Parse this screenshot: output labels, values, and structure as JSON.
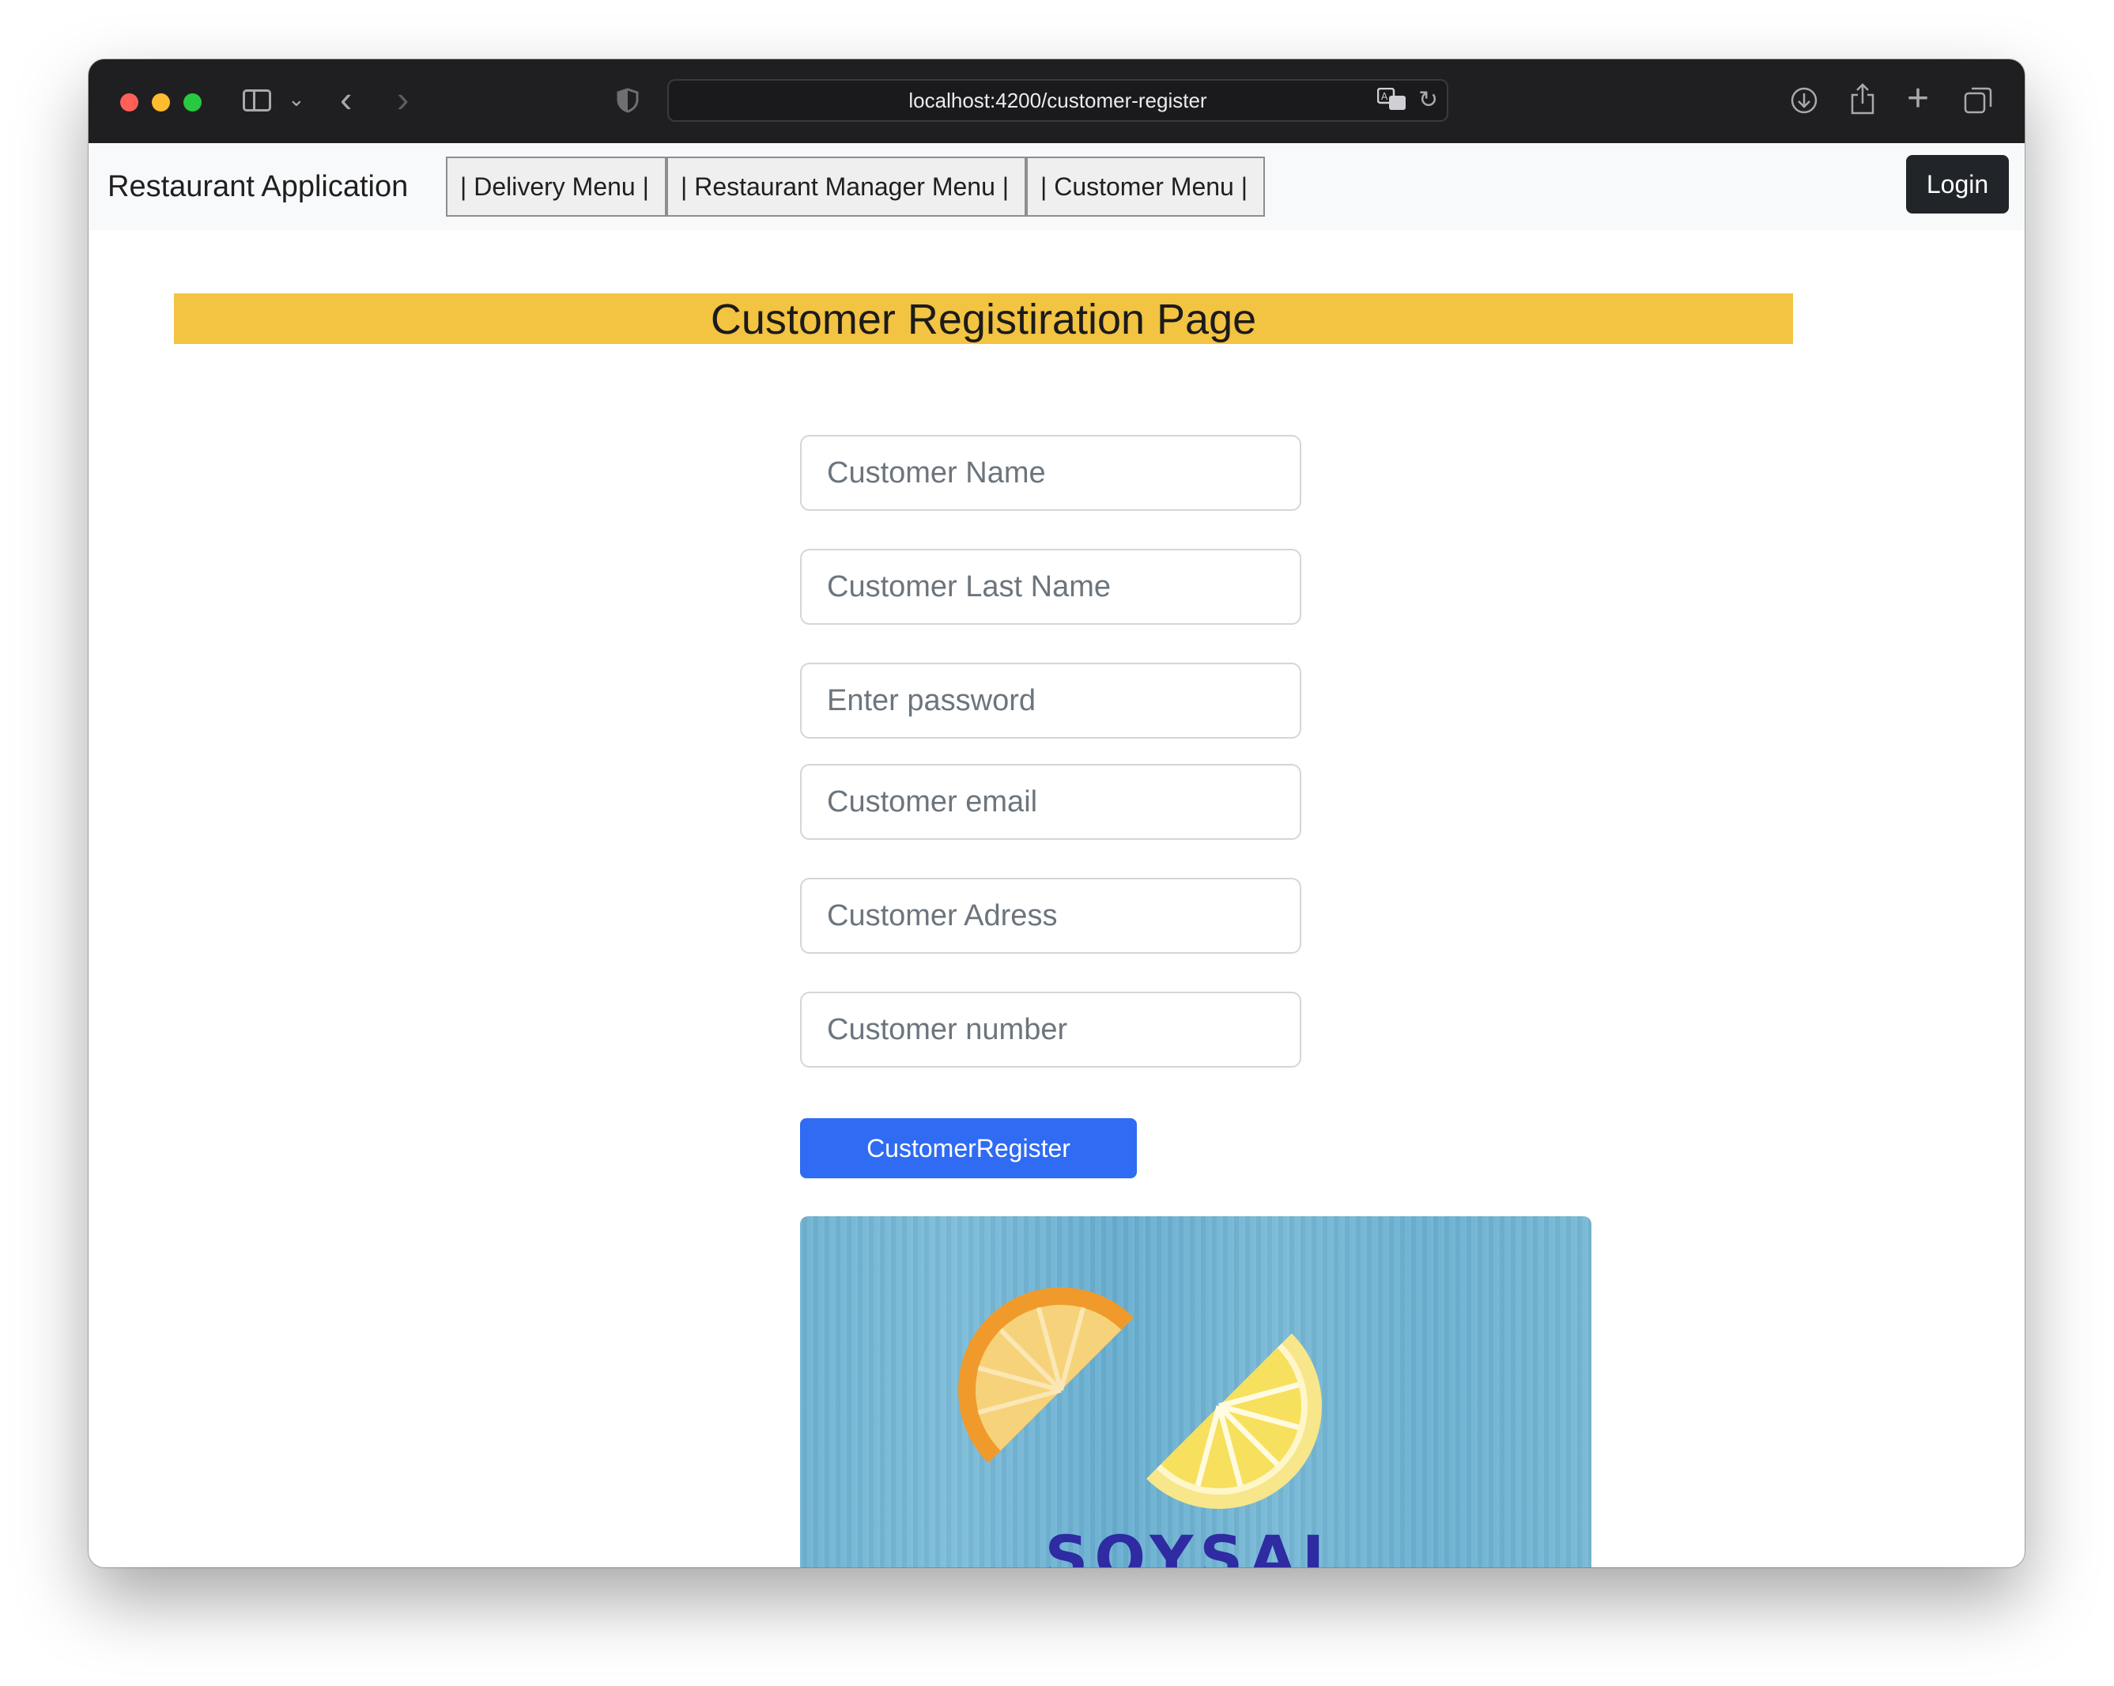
{
  "browser": {
    "url": "localhost:4200/customer-register"
  },
  "navbar": {
    "brand": "Restaurant Application",
    "links": [
      "| Delivery Menu |",
      "| Restaurant Manager Menu |",
      "| Customer Menu |"
    ],
    "login_label": "Login"
  },
  "page": {
    "heading": "Customer Registiration Page",
    "fields": [
      {
        "placeholder": "Customer Name",
        "value": ""
      },
      {
        "placeholder": "Customer Last Name",
        "value": ""
      },
      {
        "placeholder": "Enter password",
        "value": ""
      },
      {
        "placeholder": "Customer email",
        "value": ""
      },
      {
        "placeholder": "Customer Adress",
        "value": ""
      },
      {
        "placeholder": "Customer number",
        "value": ""
      }
    ],
    "register_label": "CustomerRegister",
    "banner_logo_text": "SOYSAL"
  },
  "colors": {
    "heading_bg": "#f3c342",
    "register_button": "#2f6bf3",
    "login_button": "#212529",
    "banner_bg": "#72b5d4",
    "logo_text": "#2e2ba3"
  },
  "icons": [
    "sidebar-icon",
    "chevron-down-icon",
    "back-icon",
    "forward-icon",
    "shield-icon",
    "translate-icon",
    "reload-icon",
    "download-icon",
    "share-icon",
    "new-tab-icon",
    "tabs-overview-icon"
  ]
}
